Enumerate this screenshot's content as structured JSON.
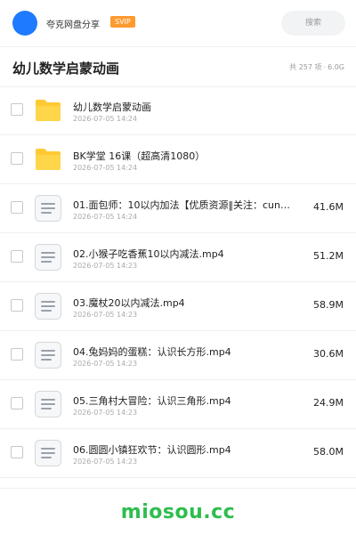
{
  "header": {
    "username": "夸克网盘分享",
    "badge": "SVIP",
    "search_label": "搜索"
  },
  "folder": {
    "title": "幼儿数学启蒙动画",
    "item_count": "共 257 项",
    "separator": "·",
    "total_size": "6.0G"
  },
  "items": [
    {
      "type": "folder",
      "name": "幼儿数学启蒙动画",
      "date": "2026-07-05 14:24",
      "size": ""
    },
    {
      "type": "folder",
      "name": "BK学堂 16课（超高清1080）",
      "date": "2026-07-05 14:24",
      "size": ""
    },
    {
      "type": "file",
      "name": "01.面包师：10以内加法【优质资源‖关注：cun…",
      "date": "2026-07-05 14:24",
      "size": "41.6M"
    },
    {
      "type": "file",
      "name": "02.小猴子吃香蕉10以内减法.mp4",
      "date": "2026-07-05 14:23",
      "size": "51.2M"
    },
    {
      "type": "file",
      "name": "03.魔杖20以内减法.mp4",
      "date": "2026-07-05 14:23",
      "size": "58.9M"
    },
    {
      "type": "file",
      "name": "04.兔妈妈的蛋糕：认识长方形.mp4",
      "date": "2026-07-05 14:23",
      "size": "30.6M"
    },
    {
      "type": "file",
      "name": "05.三角村大冒险：认识三角形.mp4",
      "date": "2026-07-05 14:23",
      "size": "24.9M"
    },
    {
      "type": "file",
      "name": "06.圆圆小镇狂欢节：认识圆形.mp4",
      "date": "2026-07-05 14:23",
      "size": "58.0M"
    }
  ],
  "icons": {
    "folder": "folder-icon",
    "file": "document-icon"
  },
  "footer": {
    "brand": "miosou.cc"
  },
  "colors": {
    "accent": "#1e7bff",
    "svip": "#ff9a2e",
    "folder": "#ffc933",
    "brand": "#2ebd4e"
  }
}
